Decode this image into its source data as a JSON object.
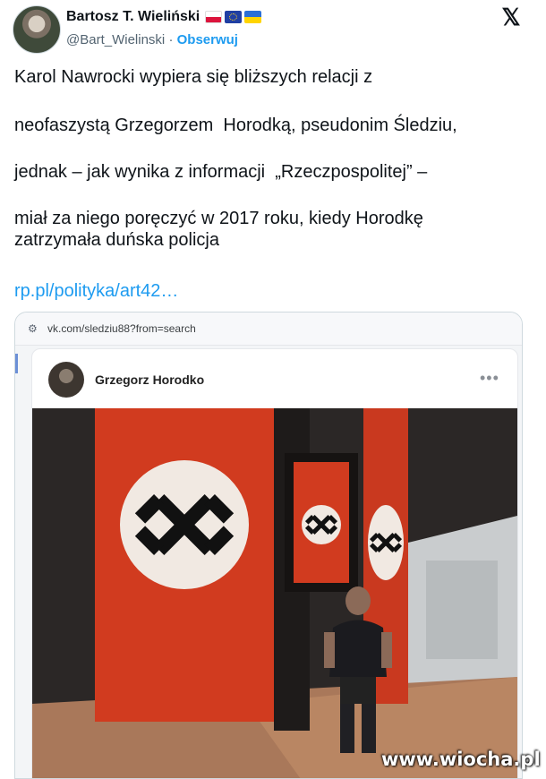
{
  "author": {
    "name": "Bartosz T. Wieliński",
    "handle": "@Bart_Wielinski",
    "separator": "·",
    "follow_label": "Obserwuj",
    "flag_icons": [
      "poland-flag-icon",
      "eu-flag-icon",
      "ukraine-flag-icon"
    ]
  },
  "platform_icon": "x-logo-icon",
  "tweet": {
    "paragraphs": [
      "Karol Nawrocki wypiera się bliższych relacji z",
      "neofaszystą Grzegorzem  Horodką, pseudonim Śledziu,",
      "jednak – jak wynika z informacji  „Rzeczpospolitej” –",
      "miał za niego poręczyć w 2017 roku, kiedy Horodkę\nzatrzymała duńska policja"
    ],
    "link_text": "rp.pl/polityka/art42…"
  },
  "embedded_screenshot": {
    "url": "vk.com/sledziu88?from=search",
    "profile_name": "Grzegorz Horodko",
    "more_label": "•••"
  },
  "watermark": "www.wiocha.pl",
  "colors": {
    "link": "#1d9bf0",
    "text": "#0f1419",
    "muted": "#536471",
    "banner_red": "#d13b1f"
  }
}
